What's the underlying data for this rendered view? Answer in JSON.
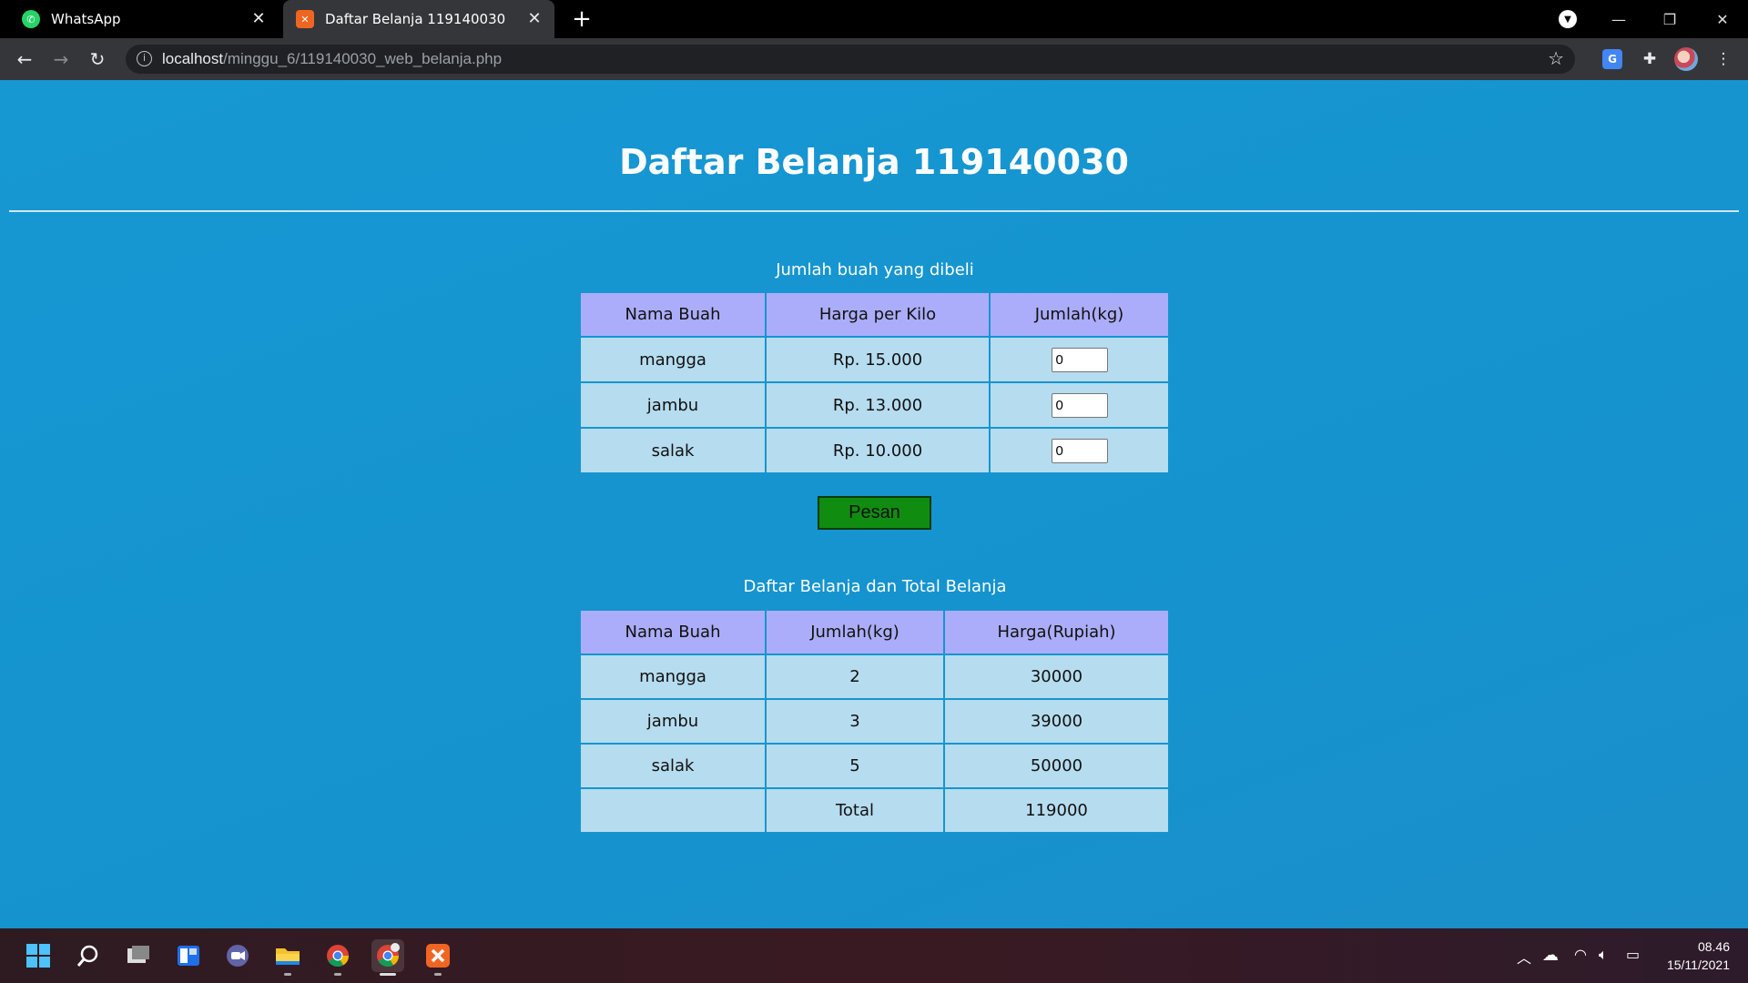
{
  "browser": {
    "tabs": [
      {
        "title": "WhatsApp",
        "icon": "whatsapp-icon"
      },
      {
        "title": "Daftar Belanja 119140030",
        "icon": "xampp-icon"
      }
    ],
    "url_host": "localhost",
    "url_path": "/minggu_6/119140030_web_belanja.php"
  },
  "page": {
    "title": "Daftar Belanja 119140030",
    "form": {
      "caption": "Jumlah buah yang dibeli",
      "headers": [
        "Nama Buah",
        "Harga per Kilo",
        "Jumlah(kg)"
      ],
      "rows": [
        {
          "name": "mangga",
          "price": "Rp. 15.000",
          "qty": "0"
        },
        {
          "name": "jambu",
          "price": "Rp. 13.000",
          "qty": "0"
        },
        {
          "name": "salak",
          "price": "Rp. 10.000",
          "qty": "0"
        }
      ],
      "submit_label": "Pesan"
    },
    "summary": {
      "caption": "Daftar Belanja dan Total Belanja",
      "headers": [
        "Nama Buah",
        "Jumlah(kg)",
        "Harga(Rupiah)"
      ],
      "rows": [
        {
          "name": "mangga",
          "qty": "2",
          "price": "30000"
        },
        {
          "name": "jambu",
          "qty": "3",
          "price": "39000"
        },
        {
          "name": "salak",
          "qty": "5",
          "price": "50000"
        }
      ],
      "total_label": "Total",
      "total_value": "119000"
    }
  },
  "taskbar": {
    "time": "08.46",
    "date": "15/11/2021"
  },
  "colors": {
    "page_bg": "#1595d1",
    "header_cell": "#abadfa",
    "body_cell": "#b6dcef",
    "submit_button": "#108c10"
  }
}
